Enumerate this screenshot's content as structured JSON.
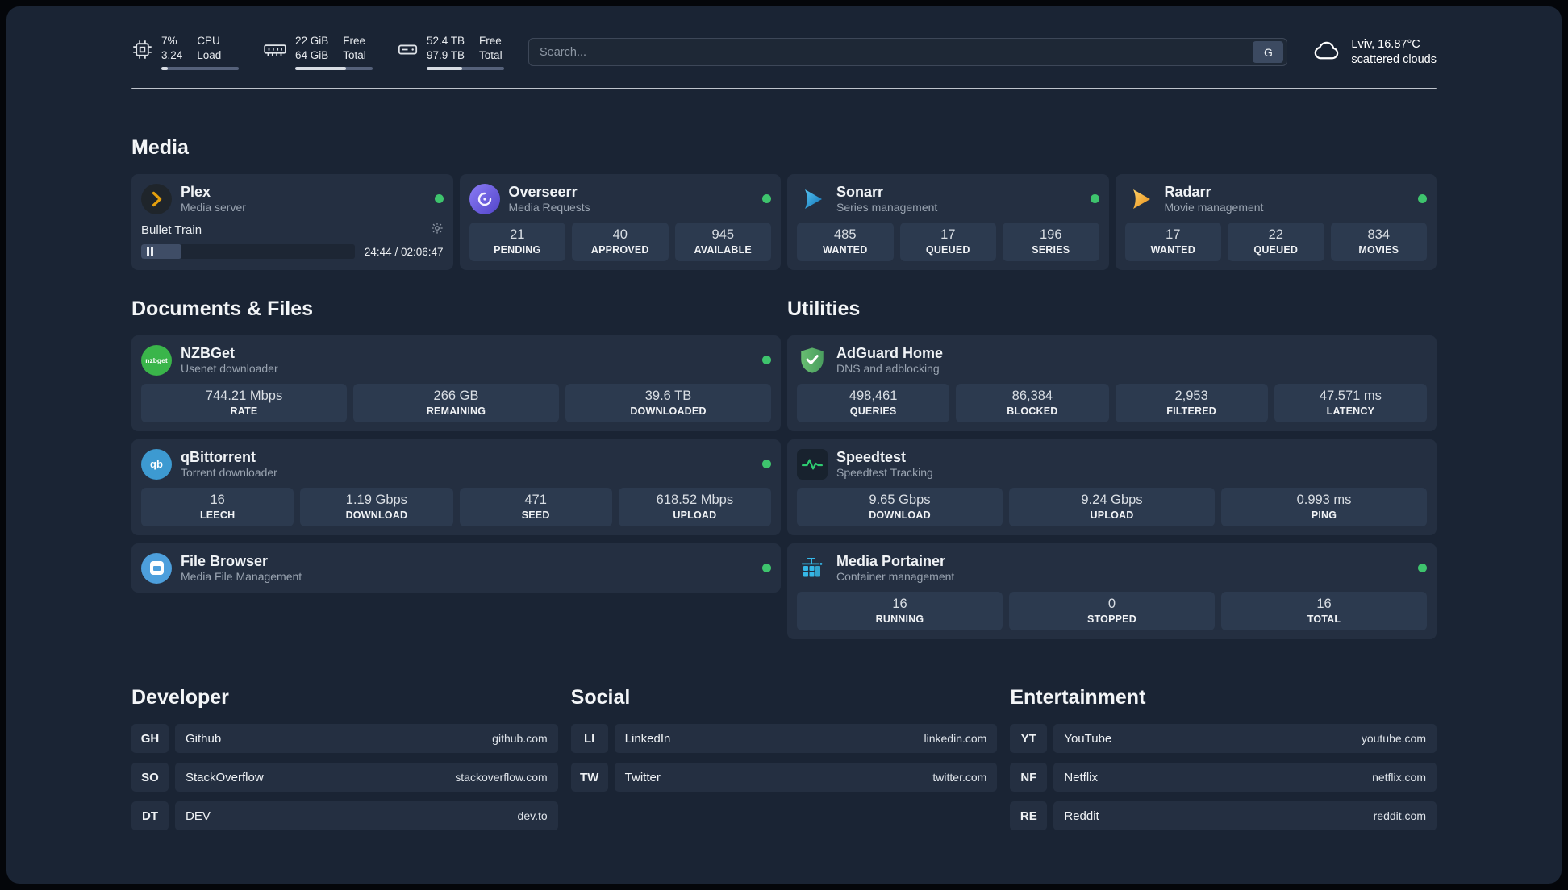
{
  "colors": {
    "page-bg": "#1a2434",
    "card-bg": "#242f41",
    "tile-bg": "#2c3a4f",
    "status-green": "#3ec46d"
  },
  "topbar": {
    "cpu": {
      "value1": "7%",
      "value2": "3.24",
      "label1": "CPU",
      "label2": "Load",
      "progress": 8
    },
    "ram": {
      "value1": "22 GiB",
      "value2": "64 GiB",
      "label1": "Free",
      "label2": "Total",
      "progress": 66
    },
    "disk": {
      "value1": "52.4 TB",
      "value2": "97.9 TB",
      "label1": "Free",
      "label2": "Total",
      "progress": 46
    },
    "search": {
      "placeholder": "Search...",
      "button": "G"
    },
    "weather": {
      "location": "Lviv, 16.87°C",
      "condition": "scattered clouds"
    }
  },
  "media": {
    "heading": "Media",
    "plex": {
      "name": "Plex",
      "subtitle": "Media server",
      "now_playing": {
        "title": "Bullet Train",
        "time": "24:44 / 02:06:47",
        "progress_pct": 19
      }
    },
    "overseerr": {
      "name": "Overseerr",
      "subtitle": "Media Requests",
      "stats": [
        {
          "value": "21",
          "label": "PENDING"
        },
        {
          "value": "40",
          "label": "APPROVED"
        },
        {
          "value": "945",
          "label": "AVAILABLE"
        }
      ]
    },
    "sonarr": {
      "name": "Sonarr",
      "subtitle": "Series management",
      "stats": [
        {
          "value": "485",
          "label": "WANTED"
        },
        {
          "value": "17",
          "label": "QUEUED"
        },
        {
          "value": "196",
          "label": "SERIES"
        }
      ]
    },
    "radarr": {
      "name": "Radarr",
      "subtitle": "Movie management",
      "stats": [
        {
          "value": "17",
          "label": "WANTED"
        },
        {
          "value": "22",
          "label": "QUEUED"
        },
        {
          "value": "834",
          "label": "MOVIES"
        }
      ]
    }
  },
  "documents": {
    "heading": "Documents & Files",
    "nzbget": {
      "name": "NZBGet",
      "subtitle": "Usenet downloader",
      "icon_text": "nzbget",
      "stats": [
        {
          "value": "744.21 Mbps",
          "label": "RATE"
        },
        {
          "value": "266 GB",
          "label": "REMAINING"
        },
        {
          "value": "39.6 TB",
          "label": "DOWNLOADED"
        }
      ]
    },
    "qbittorrent": {
      "name": "qBittorrent",
      "subtitle": "Torrent downloader",
      "icon_text": "qb",
      "stats": [
        {
          "value": "16",
          "label": "LEECH"
        },
        {
          "value": "1.19 Gbps",
          "label": "DOWNLOAD"
        },
        {
          "value": "471",
          "label": "SEED"
        },
        {
          "value": "618.52 Mbps",
          "label": "UPLOAD"
        }
      ]
    },
    "filebrowser": {
      "name": "File Browser",
      "subtitle": "Media File Management"
    }
  },
  "utilities": {
    "heading": "Utilities",
    "adguard": {
      "name": "AdGuard Home",
      "subtitle": "DNS and adblocking",
      "stats": [
        {
          "value": "498,461",
          "label": "QUERIES"
        },
        {
          "value": "86,384",
          "label": "BLOCKED"
        },
        {
          "value": "2,953",
          "label": "FILTERED"
        },
        {
          "value": "47.571 ms",
          "label": "LATENCY"
        }
      ]
    },
    "speedtest": {
      "name": "Speedtest",
      "subtitle": "Speedtest Tracking",
      "stats": [
        {
          "value": "9.65 Gbps",
          "label": "DOWNLOAD"
        },
        {
          "value": "9.24 Gbps",
          "label": "UPLOAD"
        },
        {
          "value": "0.993 ms",
          "label": "PING"
        }
      ]
    },
    "portainer": {
      "name": "Media Portainer",
      "subtitle": "Container management",
      "stats": [
        {
          "value": "16",
          "label": "RUNNING"
        },
        {
          "value": "0",
          "label": "STOPPED"
        },
        {
          "value": "16",
          "label": "TOTAL"
        }
      ]
    }
  },
  "bookmarks": {
    "developer": {
      "heading": "Developer",
      "links": [
        {
          "abbr": "GH",
          "name": "Github",
          "url": "github.com"
        },
        {
          "abbr": "SO",
          "name": "StackOverflow",
          "url": "stackoverflow.com"
        },
        {
          "abbr": "DT",
          "name": "DEV",
          "url": "dev.to"
        }
      ]
    },
    "social": {
      "heading": "Social",
      "links": [
        {
          "abbr": "LI",
          "name": "LinkedIn",
          "url": "linkedin.com"
        },
        {
          "abbr": "TW",
          "name": "Twitter",
          "url": "twitter.com"
        }
      ]
    },
    "entertainment": {
      "heading": "Entertainment",
      "links": [
        {
          "abbr": "YT",
          "name": "YouTube",
          "url": "youtube.com"
        },
        {
          "abbr": "NF",
          "name": "Netflix",
          "url": "netflix.com"
        },
        {
          "abbr": "RE",
          "name": "Reddit",
          "url": "reddit.com"
        }
      ]
    }
  }
}
